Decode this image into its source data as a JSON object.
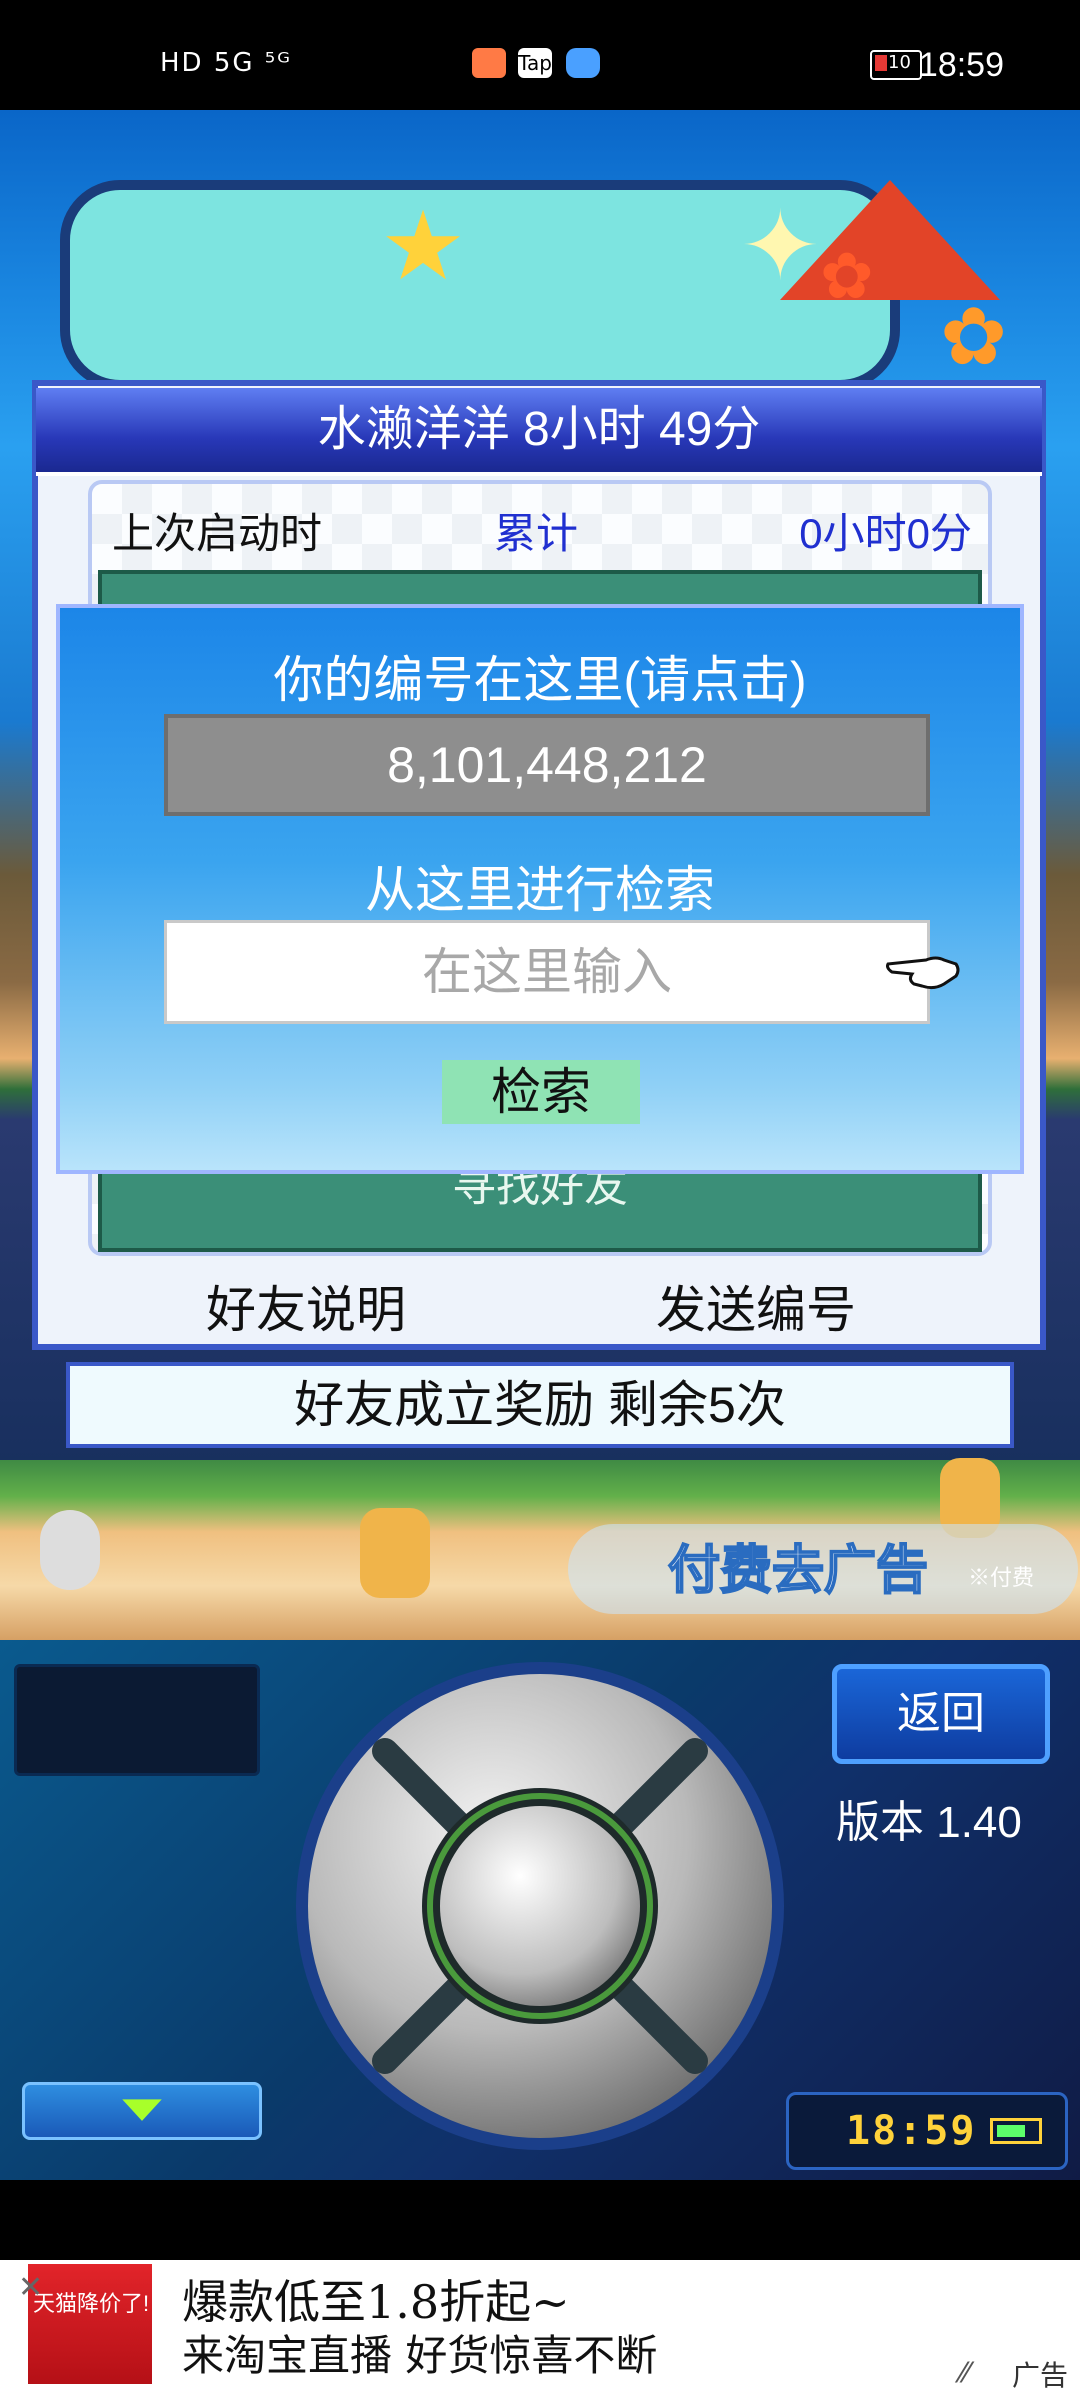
{
  "status_bar": {
    "left_indicators": "HD 5G ⁵ᴳ",
    "time": "18:59",
    "battery": "10"
  },
  "panel": {
    "title": "水濑洋洋  8小时 49分",
    "last_launch_label": "上次启动时",
    "total_label": "累计",
    "total_value": "0小时0分",
    "find_friend_label": "寻找好友",
    "friend_explain": "好友说明",
    "send_id": "发送编号"
  },
  "dialog": {
    "title": "你的编号在这里(请点击)",
    "your_id": "8,101,448,212",
    "search_from_here": "从这里进行检索",
    "search_placeholder": "在这里输入",
    "search_button": "检索"
  },
  "reward_bar": "好友成立奖励  剩余5次",
  "paid_remove_ad": "付费去广告",
  "paid_note": "※付费",
  "controls": {
    "back_button": "返回",
    "version": "版本 1.40",
    "game_clock": "18:59"
  },
  "ad": {
    "thumb_text": "天猫降价了!",
    "line1": "爆款低至1.8折起~",
    "line2": "来淘宝直播  好货惊喜不断",
    "label": "广告"
  }
}
